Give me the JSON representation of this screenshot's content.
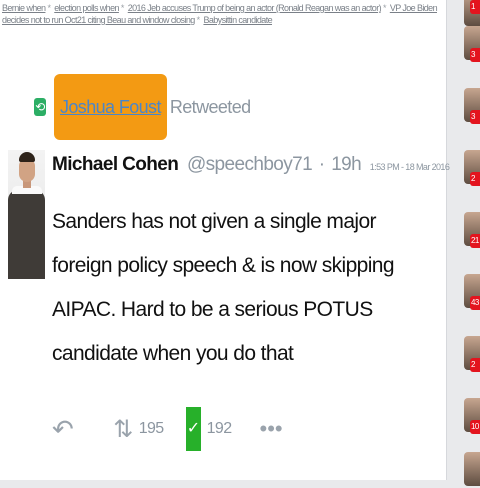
{
  "topics": [
    {
      "label": "Bernie when"
    },
    {
      "label": "election polls when"
    },
    {
      "label": "2016 Jeb accuses Trump of being an actor (Ronald Reagan was an actor)"
    },
    {
      "label": "VP Joe Biden decides not to run Oct21 citing Beau and window closing"
    },
    {
      "label": "Babysittin candidate"
    }
  ],
  "retweeter": {
    "icon": "retweet-badge-icon",
    "name": "Joshua Foust",
    "label": "Retweeted",
    "highlight_color": "#f39a13"
  },
  "tweet": {
    "author": "Michael Cohen",
    "handle": "@speechboy71",
    "age": "19h",
    "timestamp": "1:53 PM - 18 Mar 2016",
    "text": "Sanders has not given a single major foreign policy speech & is now skipping AIPAC. Hard to be a serious POTUS candidate when you do that",
    "retweet_count": "195",
    "like_count": "192",
    "like_color": "#27b02a"
  },
  "sidebar": {
    "badges": [
      "1",
      "3",
      "3",
      "2",
      "21",
      "43",
      "2",
      "10",
      ""
    ]
  }
}
